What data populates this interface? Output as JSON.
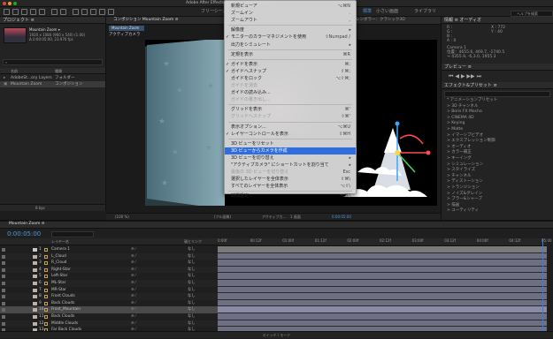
{
  "titlebar": {
    "title": "Adobe After Effects (Beta) - .../Room 2.aep *"
  },
  "toolbar": {
    "workspace_items": [
      "標準",
      "小さい画面",
      "ライブラリ"
    ],
    "align_label": "フリーシーム"
  },
  "project": {
    "panel_title": "プロジェクト ≡",
    "comp_name": "Mountain Zoom ▾",
    "comp_info_1": "1920 x 1080 (960 x 540) (1.00)",
    "comp_info_2": "Δ 0:00:05:00, 23.976 fps",
    "col_name": "名前",
    "col_type": "種類",
    "rows": [
      {
        "name": "AdobeSt...ory Layers",
        "type": "フォルダー"
      },
      {
        "name": "Mountain Zoom",
        "type": "コンポジション"
      }
    ],
    "footer_bpc": "8 bpc"
  },
  "viewer": {
    "tab_label": "コンポジション Mountain Zoom ≡",
    "comp_tab": "Mountain Zoom",
    "camera_label": "アクティブカメラ",
    "renderer": "レンダラー：クラシック3D",
    "zoom": "(100 %)",
    "quality": "(フル画質)",
    "view": "アクティブカ...",
    "views_count": "1 画面",
    "timecode": "0:00:05:00"
  },
  "menu": {
    "items": [
      {
        "label": "新規ビューア",
        "shortcut": "⌥⌘N"
      },
      {
        "label": "ズームイン",
        "shortcut": "."
      },
      {
        "label": "ズームアウト",
        "shortcut": ","
      },
      {
        "label": "解像度",
        "shortcut": "",
        "submenu": true
      },
      {
        "label": "モニターのカラーマネジメントを使用",
        "shortcut": "⇧Numpad /",
        "checked": true
      },
      {
        "label": "出力をシミュレート",
        "shortcut": "",
        "submenu": true
      },
      {
        "label": "定規を表示",
        "shortcut": "⌘R"
      },
      {
        "label": "ガイドを表示",
        "shortcut": "⌘;",
        "checked": true
      },
      {
        "label": "ガイドへスナップ",
        "shortcut": "⇧⌘;",
        "checked": true
      },
      {
        "label": "ガイドをロック",
        "shortcut": "⌥⇧⌘;"
      },
      {
        "label": "ガイドを消去",
        "shortcut": "",
        "disabled": true
      },
      {
        "label": "ガイドの読み込み...",
        "shortcut": ""
      },
      {
        "label": "ガイドの書き出し...",
        "shortcut": "",
        "disabled": true
      },
      {
        "label": "グリッドを表示",
        "shortcut": "⌘'"
      },
      {
        "label": "グリッドへスナップ",
        "shortcut": "⇧⌘'",
        "disabled": true
      },
      {
        "label": "表示オプション...",
        "shortcut": "⌥⌘U"
      },
      {
        "label": "レイヤーコントロールを表示",
        "shortcut": "⇧⌘H",
        "checked": true
      },
      {
        "label": "3D ビューをリセット",
        "shortcut": ""
      },
      {
        "label": "3D ビューからカメラを作成",
        "shortcut": "",
        "selected": true
      },
      {
        "label": "3D ビューを切り替え",
        "shortcut": "",
        "submenu": true
      },
      {
        "label": "\"アクティブカメラ\" にショートカットを割り当て",
        "shortcut": "",
        "submenu": true
      },
      {
        "label": "最後の 3D ビューを切り替え",
        "shortcut": "Esc",
        "disabled": true
      },
      {
        "label": "選択したレイヤーを全体表示",
        "shortcut": "⇧⌘\\"
      },
      {
        "label": "すべてのレイヤーを全体表示",
        "shortcut": "⌥⇧\\"
      },
      {
        "label": "時間設定...",
        "shortcut": "⌥⌘J"
      }
    ]
  },
  "right_panel": {
    "info_title": "情報 ≡   オーディオ",
    "info_lines": [
      "R :",
      "G :",
      "B :",
      "A : 0",
      "X : 772",
      "Y : 40"
    ],
    "camera_lines": [
      "Camera 1",
      "位置：4655.6, 469.7, -1740.5",
      "→ 4355.9, -6,3.0, 1955.3"
    ],
    "preview_title": "プレビュー ≡",
    "effects_title": "エフェクト&プリセット ≡",
    "effects": [
      "* アニメーションプリセット",
      "> 3D チャンネル",
      "> Boris FX Mocha",
      "> CINEMA 4D",
      "> Keying",
      "> Matte",
      "> イマーシブビデオ",
      "> エクスプレッション制御",
      "> オーディオ",
      "> カラー補正",
      "> キーイング",
      "> シミュレーション",
      "> スタイライズ",
      "> チャンネル",
      "> ディストーション",
      "> トランジション",
      "> ノイズ&グレイン",
      "> ブラー&シャープ",
      "> 描画",
      "> ユーティリティ"
    ],
    "help_title": "ヘルプを検索"
  },
  "timeline": {
    "tab_label": "Mountain Zoom ≡",
    "current_time": "0:00:05:00",
    "col_layer_name": "レイヤー名",
    "col_parent": "親とリンク",
    "footer": "スイッチ / モード",
    "ruler_ticks": [
      "0:00f",
      "00:12f",
      "01:00f",
      "01:12f",
      "02:00f",
      "02:12f",
      "03:00f",
      "03:12f",
      "04:00f",
      "04:12f",
      "05:00"
    ],
    "layers": [
      {
        "num": "1",
        "name": "Camera 1",
        "parent": "なし",
        "label": "#c8c8c8"
      },
      {
        "num": "2",
        "name": "L_Cloud",
        "parent": "なし",
        "label": "#b9b2a6"
      },
      {
        "num": "3",
        "name": "R_Cloud",
        "parent": "なし",
        "label": "#b9b2a6"
      },
      {
        "num": "4",
        "name": "Right-Star",
        "parent": "なし",
        "label": "#b9b2a6"
      },
      {
        "num": "5",
        "name": "Left-Star",
        "parent": "なし",
        "label": "#b9b2a6"
      },
      {
        "num": "6",
        "name": "ML-Star",
        "parent": "なし",
        "label": "#b9b2a6"
      },
      {
        "num": "7",
        "name": "MR-Star",
        "parent": "なし",
        "label": "#b9b2a6"
      },
      {
        "num": "8",
        "name": "Front Clouds",
        "parent": "なし",
        "label": "#b9b2a6"
      },
      {
        "num": "9",
        "name": "Back Clouds",
        "parent": "なし",
        "label": "#b9b2a6"
      },
      {
        "num": "10",
        "name": "Front_Mountain",
        "parent": "なし",
        "label": "#b9b2a6",
        "selected": true
      },
      {
        "num": "11",
        "name": "Back Clouds",
        "parent": "なし",
        "label": "#b9b2a6"
      },
      {
        "num": "12",
        "name": "Middle Clouds",
        "parent": "なし",
        "label": "#b9b2a6"
      },
      {
        "num": "13",
        "name": "Far Back Clouds",
        "parent": "なし",
        "label": "#b9b2a6"
      }
    ]
  },
  "colors": {
    "accent": "#2f6ede",
    "timecode": "#4d96e0",
    "track": "#6f6f84"
  }
}
